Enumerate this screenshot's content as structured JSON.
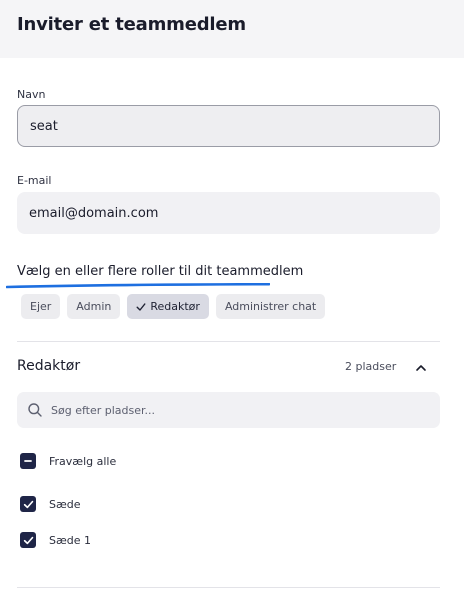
{
  "header": {
    "title": "Inviter et teammedlem"
  },
  "form": {
    "name_label": "Navn",
    "name_value": "seat",
    "email_label": "E-mail",
    "email_value": "email@domain.com",
    "roles_prompt": "Vælg en eller flere roller til dit teammedlem"
  },
  "roles": [
    {
      "label": "Ejer",
      "selected": false
    },
    {
      "label": "Admin",
      "selected": false
    },
    {
      "label": "Redaktør",
      "selected": true
    },
    {
      "label": "Administrer chat",
      "selected": false
    }
  ],
  "seats_section": {
    "title": "Redaktør",
    "count": "2 pladser",
    "expanded": true,
    "search_placeholder": "Søg efter pladser...",
    "deselect_all_label": "Fravælg alle",
    "items": [
      {
        "label": "Sæde",
        "checked": true
      },
      {
        "label": "Sæde 1",
        "checked": true
      }
    ]
  },
  "colors": {
    "accent_underline": "#1e6fe0",
    "checkbox": "#1f2547",
    "selected_chip": "#d9dae3"
  }
}
